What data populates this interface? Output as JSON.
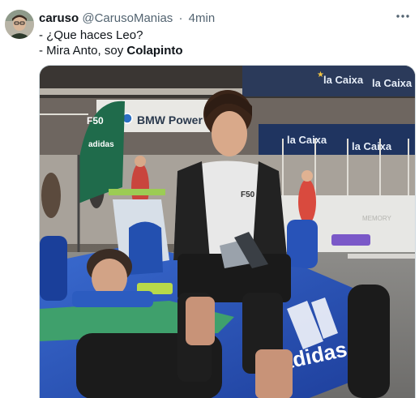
{
  "tweet": {
    "author": {
      "display_name": "caruso",
      "handle": "@CarusoManias",
      "timestamp": "4min",
      "separator": "·"
    },
    "more_icon": "more-horizontal-icon",
    "lines": [
      {
        "text": "- ¿Que haces Leo?"
      },
      {
        "prefix": "- Mira Anto, soy ",
        "bold": "Colapinto"
      }
    ],
    "media": {
      "signage": {
        "fso": "F50",
        "bmw": "BMW Power",
        "caixa_1": "la Caixa",
        "caixa_2": "la Caixa",
        "caixa_3": "la Caixa",
        "caixa_4": "la Caixa",
        "adidas_flag": "adidas",
        "shirt_logo": "F50",
        "car_adidas": "adidas",
        "watermark": "MEMORY"
      }
    }
  }
}
